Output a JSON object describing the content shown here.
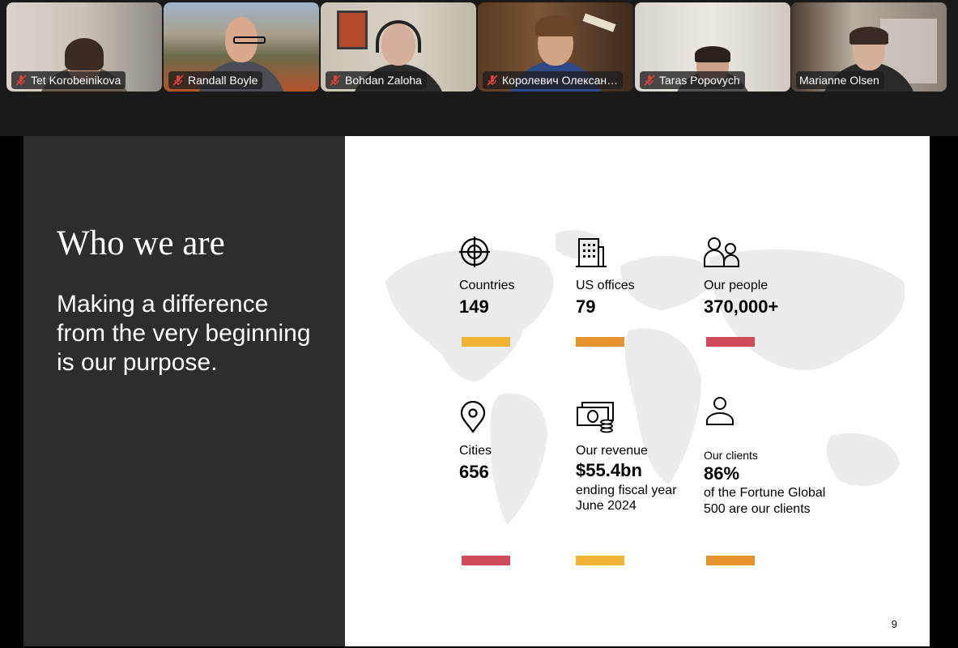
{
  "participants": [
    {
      "name": "Tet Korobeinikova",
      "muted": true
    },
    {
      "name": "Randall Boyle",
      "muted": true
    },
    {
      "name": "Bohdan Zaloha",
      "muted": true
    },
    {
      "name": "Королевич Олексан…",
      "muted": true
    },
    {
      "name": "Taras Popovych",
      "muted": true
    },
    {
      "name": "Marianne Olsen",
      "muted": false,
      "active_speaker": true
    }
  ],
  "slide": {
    "title": "Who we are",
    "subtitle": "Making a difference from the very beginning is our purpose.",
    "page_number": "9",
    "stats": [
      {
        "icon": "globe-crosshair-icon",
        "label": "Countries",
        "value": "149",
        "note": "",
        "bar_color": "#f1b434"
      },
      {
        "icon": "office-building-icon",
        "label": "US offices",
        "value": "79",
        "note": "",
        "bar_color": "#e4932f"
      },
      {
        "icon": "people-icon",
        "label": "Our people",
        "value": "370,000+",
        "note": "",
        "bar_color": "#d04a5a"
      },
      {
        "icon": "location-pin-icon",
        "label": "Cities",
        "value": "656",
        "note": "",
        "bar_color": "#d04a5a"
      },
      {
        "icon": "money-stack-icon",
        "label": "Our revenue",
        "value": "$55.4bn",
        "note": "ending fiscal year June 2024",
        "bar_color": "#f1b434"
      },
      {
        "icon": "person-icon",
        "label": "Our clients",
        "value": "86%",
        "note": "of the Fortune Global 500 are our clients",
        "bar_color": "#e4932f"
      }
    ]
  },
  "colors": {
    "active_speaker_border": "#2ecc5a",
    "slide_dark_panel": "#2d2d2d",
    "muted_icon": "#e0403a"
  }
}
